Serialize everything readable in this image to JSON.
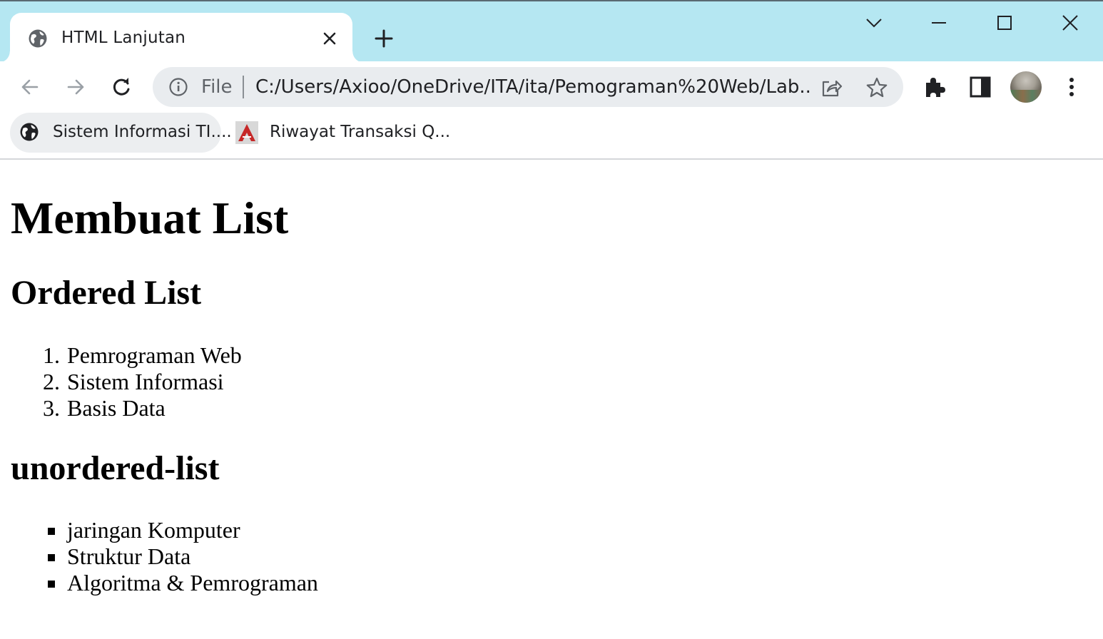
{
  "tab": {
    "title": "HTML Lanjutan",
    "favicon": "globe-icon",
    "close_icon": "close-icon"
  },
  "window_controls": [
    "chevron-down-icon",
    "minimize-icon",
    "maximize-icon",
    "close-icon"
  ],
  "toolbar": {
    "back_icon": "arrow-left-icon",
    "forward_icon": "arrow-right-icon",
    "reload_icon": "reload-icon",
    "address": {
      "scheme_label": "File",
      "url": "C:/Users/Axioo/OneDrive/ITA/ita/Pemograman%20Web/Lab..."
    },
    "extensions_icon": "puzzle-icon",
    "side_panel_icon": "side-panel-icon",
    "menu_icon": "kebab-menu-icon"
  },
  "bookmarks": [
    {
      "label": "Sistem Informasi TI....",
      "icon": "globe-icon"
    },
    {
      "label": "Riwayat Transaksi Q...",
      "icon": "site-logo-icon"
    }
  ],
  "content": {
    "heading": "Membuat List",
    "ordered_heading": "Ordered List",
    "ordered_items": [
      {
        "marker": "1.",
        "text": "Pemrograman Web"
      },
      {
        "marker": "2.",
        "text": "Sistem Informasi"
      },
      {
        "marker": "3.",
        "text": "Basis Data"
      }
    ],
    "unordered_heading": "unordered-list",
    "unordered_items": [
      {
        "text": "jaringan Komputer"
      },
      {
        "text": "Struktur Data"
      },
      {
        "text": "Algoritma & Pemrograman"
      }
    ]
  },
  "colors": {
    "titlebar": "#b5e7f2",
    "omnibox": "#e9ecef",
    "text": "#202124"
  }
}
